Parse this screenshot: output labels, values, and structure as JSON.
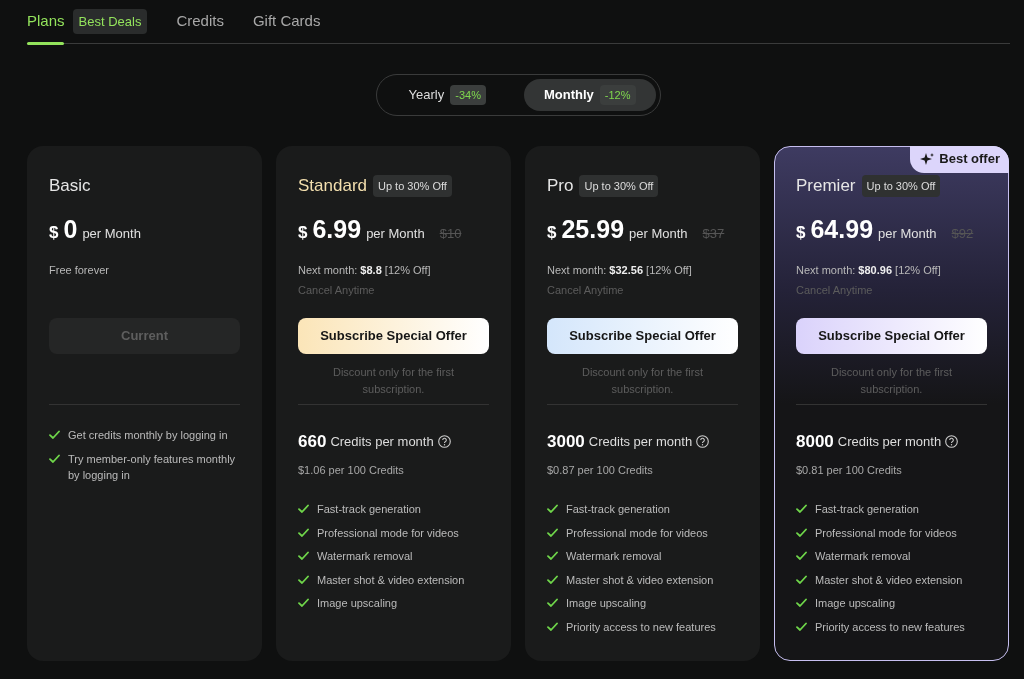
{
  "tabs": [
    {
      "label": "Plans",
      "selected": true,
      "badge": "Best Deals"
    },
    {
      "label": "Credits",
      "selected": false
    },
    {
      "label": "Gift Cards",
      "selected": false
    }
  ],
  "billing_toggle": [
    {
      "label": "Yearly",
      "discount": "-34%",
      "selected": false
    },
    {
      "label": "Monthly",
      "discount": "-12%",
      "selected": true
    }
  ],
  "plans": [
    {
      "name": "Basic",
      "featured": false,
      "currency": "$",
      "price": "0",
      "period": "per Month",
      "info": [
        "Free forever"
      ],
      "button": {
        "label": "Current",
        "disabled": true
      },
      "features": [
        "Get credits monthly by logging in",
        "Try member-only features monthly by logging in"
      ]
    },
    {
      "name": "Standard",
      "color": "#f3dfae",
      "tag": "Up to 30% Off",
      "featured": false,
      "currency": "$",
      "price": "6.99",
      "period": "per Month",
      "old_price": "$10",
      "info": [
        "Next month: **$8.8** [12% Off]",
        "Cancel Anytime"
      ],
      "button": {
        "label": "Subscribe Special Offer",
        "disabled": false,
        "color": "#fbe5b8"
      },
      "discount_note": "Discount only for the first subscription.",
      "credits": {
        "amount": "660",
        "label": "Credits per month",
        "rate": "$1.06 per 100 Credits"
      },
      "features": [
        "Fast-track generation",
        "Professional mode for videos",
        "Watermark removal",
        "Master shot & video extension",
        "Image upscaling"
      ]
    },
    {
      "name": "Pro",
      "tag": "Up to 30% Off",
      "featured": false,
      "currency": "$",
      "price": "25.99",
      "period": "per Month",
      "old_price": "$37",
      "info": [
        "Next month: **$32.56** [12% Off]",
        "Cancel Anytime"
      ],
      "button": {
        "label": "Subscribe Special Offer",
        "disabled": false,
        "color": "#d4e6fb"
      },
      "discount_note": "Discount only for the first subscription.",
      "credits": {
        "amount": "3000",
        "label": "Credits per month",
        "rate": "$0.87 per 100 Credits"
      },
      "features": [
        "Fast-track generation",
        "Professional mode for videos",
        "Watermark removal",
        "Master shot & video extension",
        "Image upscaling",
        "Priority access to new features"
      ]
    },
    {
      "name": "Premier",
      "tag": "Up to 30% Off",
      "featured": true,
      "ribbon": "Best offer",
      "currency": "$",
      "price": "64.99",
      "period": "per Month",
      "old_price": "$92",
      "info": [
        "Next month: **$80.96** [12% Off]",
        "Cancel Anytime"
      ],
      "button": {
        "label": "Subscribe Special Offer",
        "disabled": false,
        "color": "#dad2fb"
      },
      "discount_note": "Discount only for the first subscription.",
      "credits": {
        "amount": "8000",
        "label": "Credits per month",
        "rate": "$0.81 per 100 Credits"
      },
      "features": [
        "Fast-track generation",
        "Professional mode for videos",
        "Watermark removal",
        "Master shot & video extension",
        "Image upscaling",
        "Priority access to new features"
      ]
    }
  ]
}
